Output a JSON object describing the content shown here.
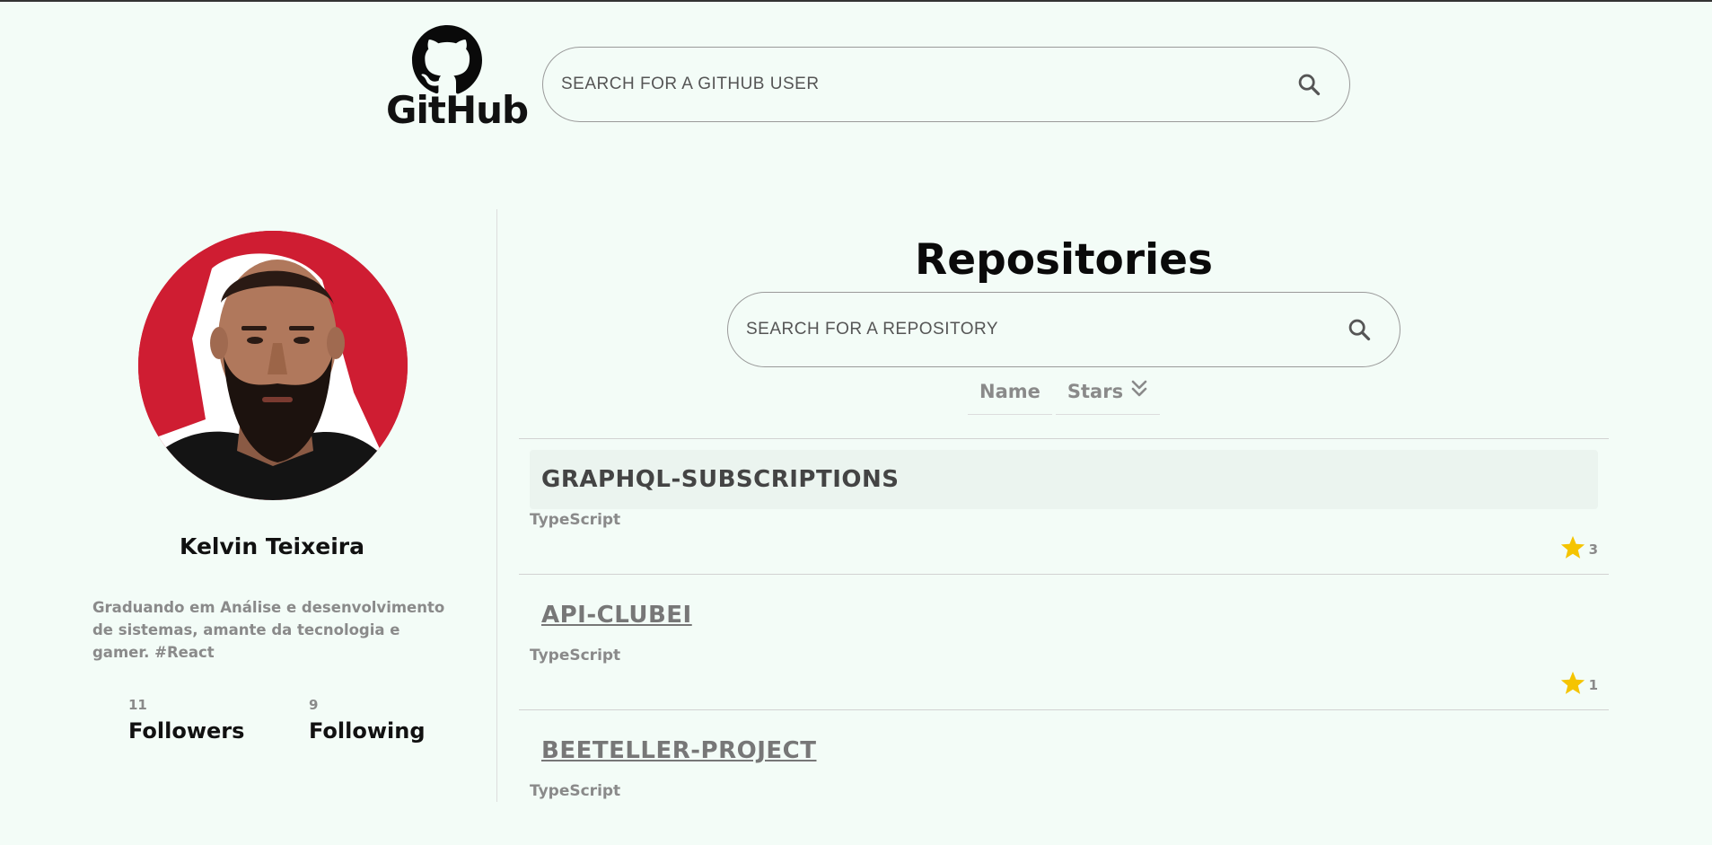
{
  "header": {
    "logo_text": "GitHub",
    "user_search_placeholder": "SEARCH FOR A GITHUB USER"
  },
  "profile": {
    "name": "Kelvin Teixeira",
    "bio": "Graduando em Análise e desenvolvimento de sistemas, amante da tecnologia e gamer. #React",
    "followers": {
      "count": "11",
      "label": "Followers"
    },
    "following": {
      "count": "9",
      "label": "Following"
    }
  },
  "repositories": {
    "title": "Repositories",
    "search_placeholder": "SEARCH FOR A REPOSITORY",
    "sort": {
      "name_label": "Name",
      "stars_label": "Stars"
    },
    "items": [
      {
        "name": "GRAPHQL-SUBSCRIPTIONS",
        "language": "TypeScript",
        "stars": "3"
      },
      {
        "name": "API-CLUBEI",
        "language": "TypeScript",
        "stars": "1"
      },
      {
        "name": "BEETELLER-PROJECT",
        "language": "TypeScript",
        "stars": ""
      }
    ]
  },
  "colors": {
    "background": "#f3fcf7",
    "avatar_bg": "#cf1d32",
    "star": "#f5c400"
  }
}
